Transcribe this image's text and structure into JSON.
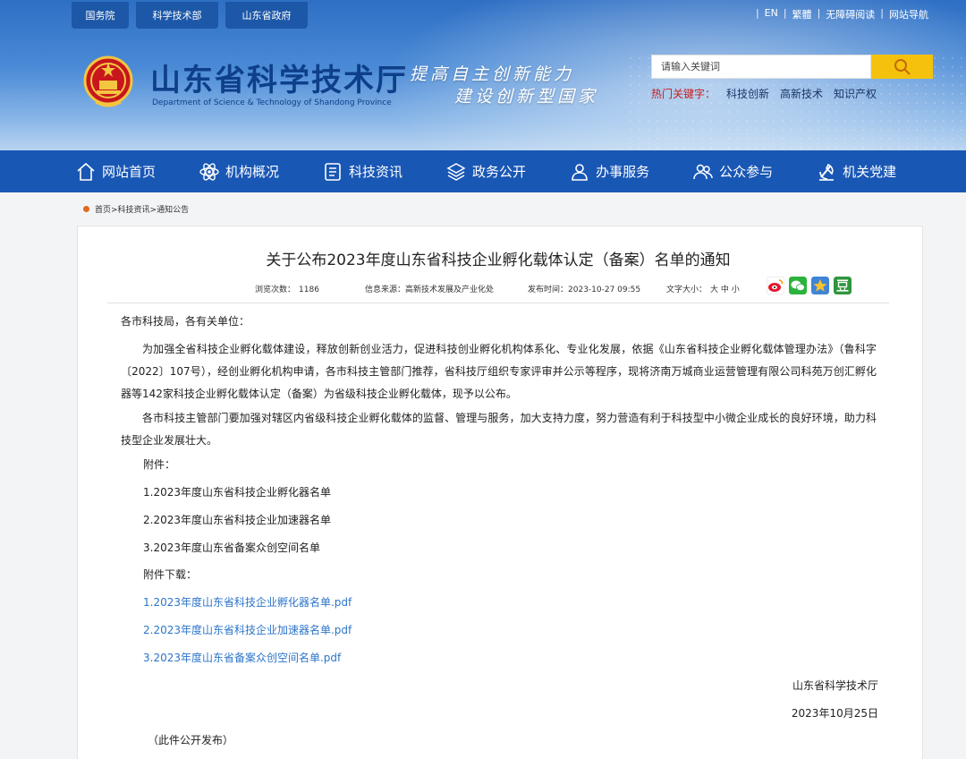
{
  "header": {
    "top_tabs": [
      "国务院",
      "科学技术部",
      "山东省政府"
    ],
    "top_links": [
      "EN",
      "繁體",
      "无障碍阅读",
      "网站导航"
    ],
    "site_title": "山东省科学技术厅",
    "site_subtitle": "Department of Science & Technology of Shandong Province",
    "slogan_line1": "提高自主创新能力",
    "slogan_line2": "建设创新型国家",
    "search_placeholder": "请输入关键词",
    "hot_label": "热门关键字：",
    "hot_keywords": [
      "科技创新",
      "高新技术",
      "知识产权"
    ]
  },
  "nav": {
    "items": [
      {
        "label": "网站首页",
        "icon": "home-icon"
      },
      {
        "label": "机构概况",
        "icon": "atom-icon"
      },
      {
        "label": "科技资讯",
        "icon": "news-icon"
      },
      {
        "label": "政务公开",
        "icon": "layers-icon"
      },
      {
        "label": "办事服务",
        "icon": "person-service-icon"
      },
      {
        "label": "公众参与",
        "icon": "people-icon"
      },
      {
        "label": "机关党建",
        "icon": "party-icon"
      }
    ]
  },
  "breadcrumb": "首页>科技资讯>通知公告",
  "article": {
    "title": "关于公布2023年度山东省科技企业孵化载体认定（备案）名单的通知",
    "views_label": "浏览次数：",
    "views": "1186",
    "source_label": "信息来源：",
    "source": "高新技术发展及产业化处",
    "date_label": "发布时间：",
    "date": "2023-10-27 09:55",
    "font_label": "文字大小：",
    "font_sizes": "大 中 小",
    "salutation": "各市科技局，各有关单位：",
    "para1": "为加强全省科技企业孵化载体建设，释放创新创业活力，促进科技创业孵化机构体系化、专业化发展，依据《山东省科技企业孵化载体管理办法》（鲁科字〔2022〕107号），经创业孵化机构申请，各市科技主管部门推荐，省科技厅组织专家评审并公示等程序，现将济南万城商业运营管理有限公司科苑万创汇孵化器等142家科技企业孵化载体认定（备案）为省级科技企业孵化载体，现予以公布。",
    "para2": "各市科技主管部门要加强对辖区内省级科技企业孵化载体的监督、管理与服务，加大支持力度，努力营造有利于科技型中小微企业成长的良好环境，助力科技型企业发展壮大。",
    "attach_label": "附件：",
    "attachments": [
      "1.2023年度山东省科技企业孵化器名单",
      "2.2023年度山东省科技企业加速器名单",
      "3.2023年度山东省备案众创空间名单"
    ],
    "download_label": "附件下载：",
    "downloads": [
      "1.2023年度山东省科技企业孵化器名单.pdf",
      "2.2023年度山东省科技企业加速器名单.pdf",
      "3.2023年度山东省备案众创空间名单.pdf"
    ],
    "signature": "山东省科学技术厅",
    "sign_date": "2023年10月25日",
    "footer_note": "（此件公开发布）"
  },
  "colors": {
    "nav_bg": "#1957b5",
    "header_title": "#0e3f8a",
    "search_button": "#f4c20d",
    "link": "#2d75c8",
    "hot_label": "#c5201c"
  }
}
